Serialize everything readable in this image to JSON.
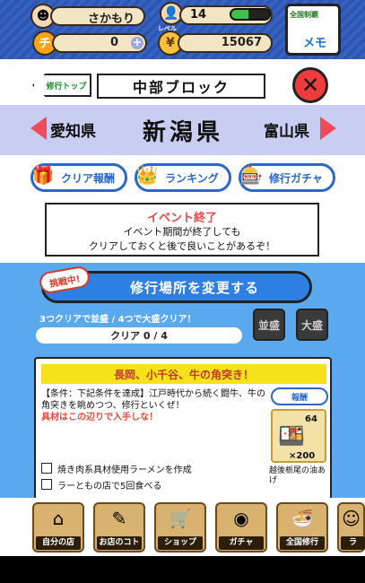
{
  "status": {
    "player_name": "さかもり",
    "level_label": "レベル",
    "level": "14",
    "xp_fraction": 0.45,
    "ticket_count": "0",
    "coins": "15067",
    "memo_top": "全国制覇",
    "memo_label": "メモ"
  },
  "header": {
    "back_label": "修行トップ",
    "block_name": "中部ブロック"
  },
  "prefecture_nav": {
    "prev": "愛知県",
    "current": "新潟県",
    "next": "富山県"
  },
  "actions": {
    "reward_label": "クリア報酬",
    "ranking_label": "ランキング",
    "gacha_label": "修行ガチャ"
  },
  "event": {
    "title": "イベント終了",
    "line1": "イベント期間が終了しても",
    "line2": "クリアしておくと後で良いことがあるぞ！"
  },
  "challenge": {
    "badge": "挑戦中!",
    "change_label": "修行場所を変更する",
    "hint": "3つクリアで並盛 / 4つで大盛クリア！",
    "progress": "クリア 0 / 4",
    "seal1": "並盛",
    "seal2": "大盛"
  },
  "detail": {
    "title": "長岡、小千谷、牛の角突き！",
    "condition_line": "【条件：下記条件を達成】江戸時代から続く闘牛、牛の角突きを眺めつつ、修行といくぜ！",
    "condition_highlight": "具材はこの辺りで入手しな！",
    "reward_badge": "報酬",
    "reward_qty_top": "64",
    "reward_qty_bottom": "×200",
    "reward_name": "越後栃尾の油あげ",
    "checklist": [
      "焼き肉系具材使用ラーメンを作成",
      "ラーともの店で5回食べる"
    ]
  },
  "bottom_nav": [
    {
      "label": "自分の店",
      "icon": "⌂"
    },
    {
      "label": "お店のコト",
      "icon": "✎"
    },
    {
      "label": "ショップ",
      "icon": "🛒"
    },
    {
      "label": "ガチャ",
      "icon": "◉"
    },
    {
      "label": "全国修行",
      "icon": "🍜"
    },
    {
      "label": "ラ",
      "icon": "☺"
    }
  ]
}
